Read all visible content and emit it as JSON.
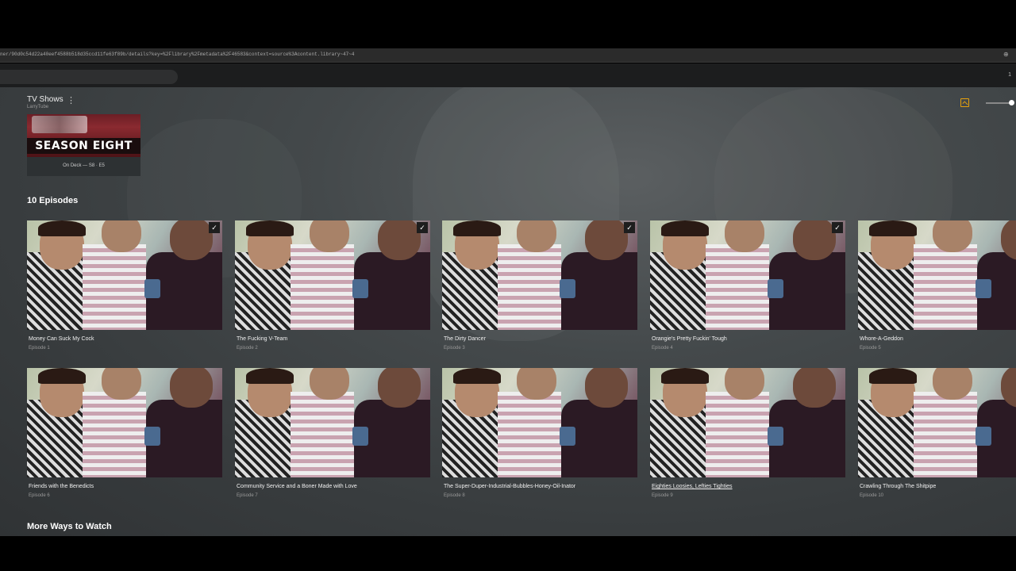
{
  "browser": {
    "url": "ner/90d0c54d22a40eef4588b518d35ccd11fe63f89b/details?key=%2Flibrary%2Fmetadata%2F46583&context=source%3Acontent.library~47~4",
    "tab_count": "1"
  },
  "header": {
    "library_title": "TV Shows",
    "library_subtitle": "LarryTube"
  },
  "season_card": {
    "art_text": "SEASON EIGHT",
    "caption": "On Deck — S8 · E5"
  },
  "episodes_section": {
    "title": "10 Episodes",
    "items": [
      {
        "title": "Money Can Suck My Cock",
        "episode": "Episode 1",
        "watched": true
      },
      {
        "title": "The Fucking V-Team",
        "episode": "Episode 2",
        "watched": true
      },
      {
        "title": "The Dirty Dancer",
        "episode": "Episode 3",
        "watched": true
      },
      {
        "title": "Orangie's Pretty Fuckin' Tough",
        "episode": "Episode 4",
        "watched": true
      },
      {
        "title": "Whore-A-Geddon",
        "episode": "Episode 5",
        "watched": false
      },
      {
        "title": "Friends with the Benedicts",
        "episode": "Episode 6",
        "watched": false
      },
      {
        "title": "Community Service and a Boner Made with Love",
        "episode": "Episode 7",
        "watched": false
      },
      {
        "title": "The Super-Duper-Industrial-Bubbles-Honey-Oil-Inator",
        "episode": "Episode 8",
        "watched": false
      },
      {
        "title": "Eighties Loosies, Lefties Tighties",
        "episode": "Episode 9",
        "watched": false
      },
      {
        "title": "Crawling Through The Shitpipe",
        "episode": "Episode 10",
        "watched": false
      }
    ]
  },
  "more_section": {
    "title": "More Ways to Watch"
  },
  "icons": {
    "zoom": "zoom-icon",
    "more": "more-vertical-icon",
    "view_toggle": "image-view-icon",
    "check": "checkmark-icon"
  },
  "colors": {
    "accent": "#e5a00d",
    "background": "#383c3e"
  }
}
